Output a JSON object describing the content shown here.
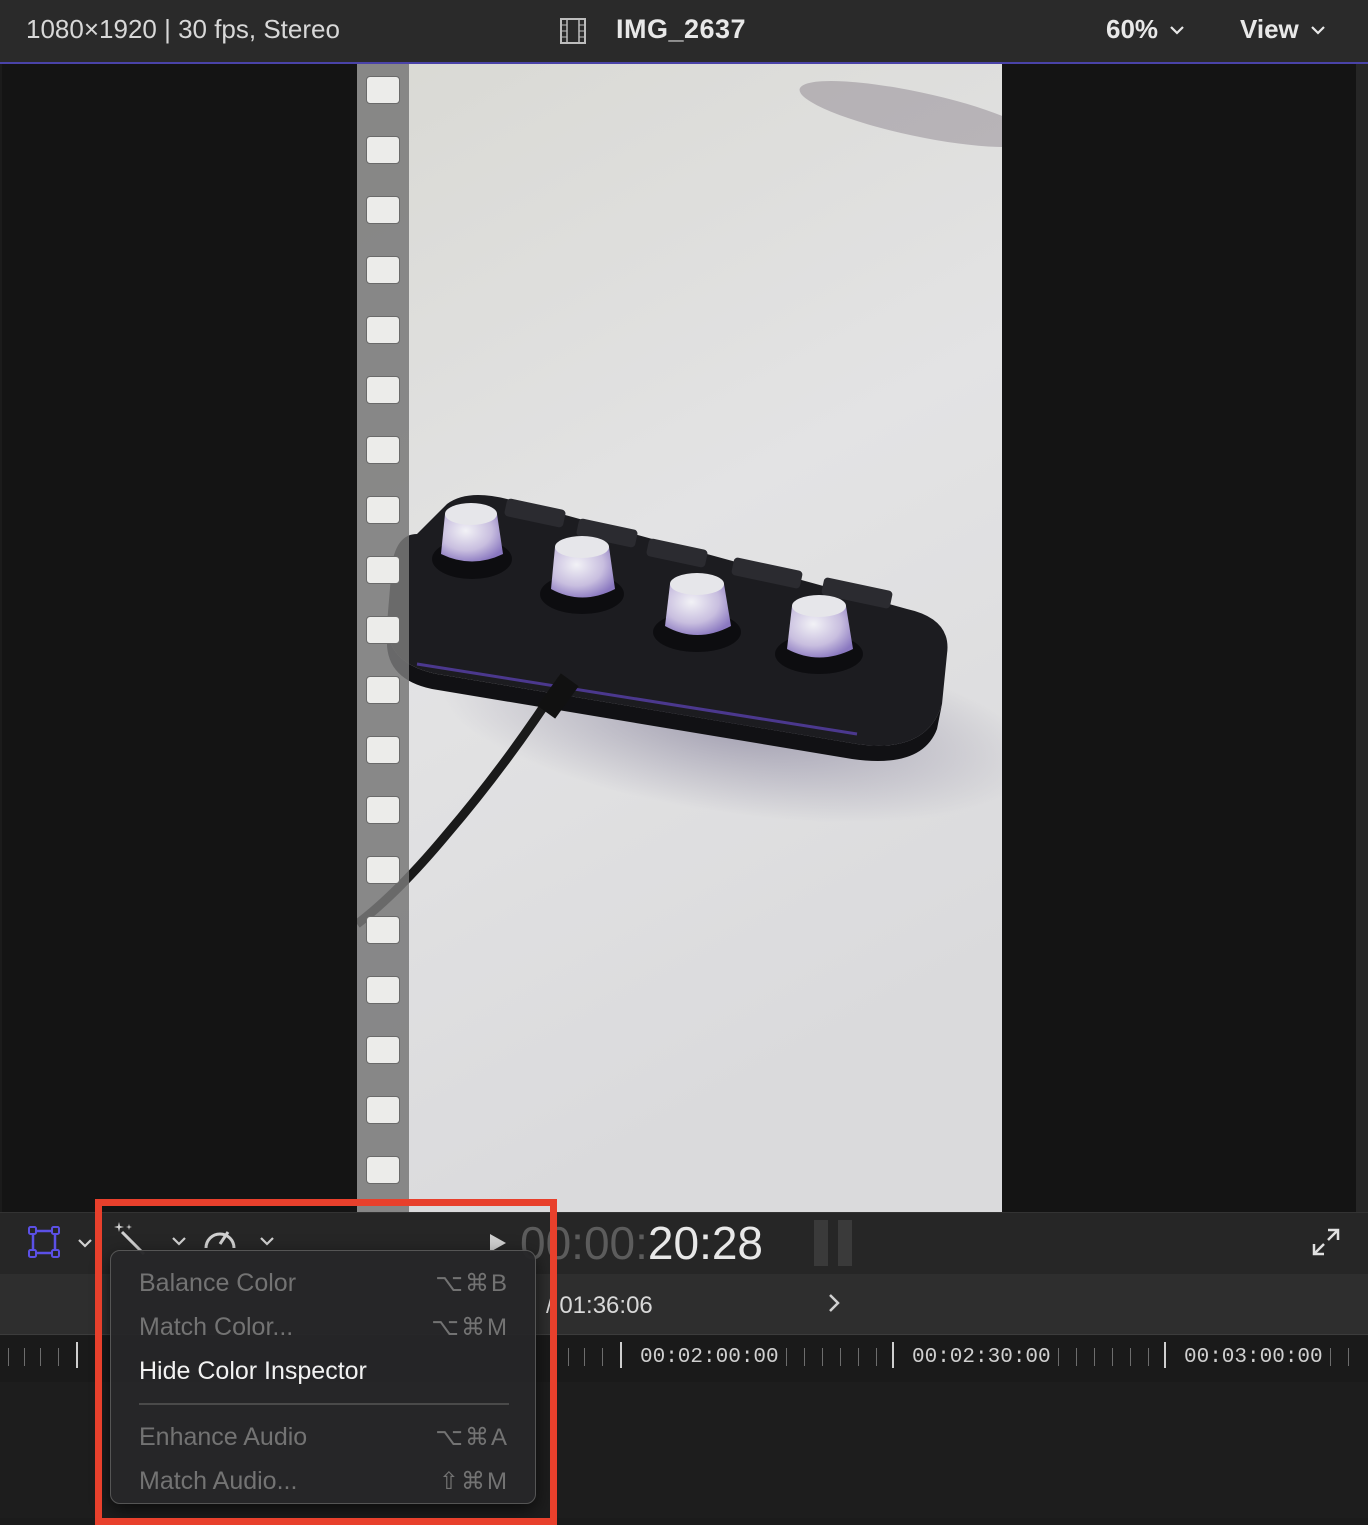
{
  "viewer_header": {
    "format_info": "1080×1920 | 30 fps, Stereo",
    "clip_name": "IMG_2637",
    "zoom_label": "60%",
    "view_label": "View",
    "icons": {
      "film": "film-strip-icon",
      "chevron": "chevron-down-icon"
    }
  },
  "transport": {
    "timecode_dim": "00:00:",
    "timecode_bright": "20:28",
    "icons": [
      "transform-icon",
      "magic-wand-icon",
      "speedometer-icon",
      "play-icon",
      "audio-meter-icon",
      "fullscreen-icon"
    ]
  },
  "timeline_index": {
    "duration_text": "/ 01:36:06"
  },
  "ruler": {
    "labels": [
      "00:02:00:00",
      "00:02:30:00",
      "00:03:00:00"
    ]
  },
  "popup_menu": {
    "items": [
      {
        "label": "Balance Color",
        "shortcut": "⌥⌘B",
        "enabled": false
      },
      {
        "label": "Match Color...",
        "shortcut": "⌥⌘M",
        "enabled": false
      },
      {
        "label": "Hide Color Inspector",
        "shortcut": "",
        "enabled": true
      },
      {
        "label": "Enhance Audio",
        "shortcut": "⌥⌘A",
        "enabled": false
      },
      {
        "label": "Match Audio...",
        "shortcut": "⇧⌘M",
        "enabled": false
      }
    ]
  },
  "colors": {
    "accent": "#5b50e6",
    "highlight_box": "#e8402c",
    "background": "#1b1b1b"
  }
}
